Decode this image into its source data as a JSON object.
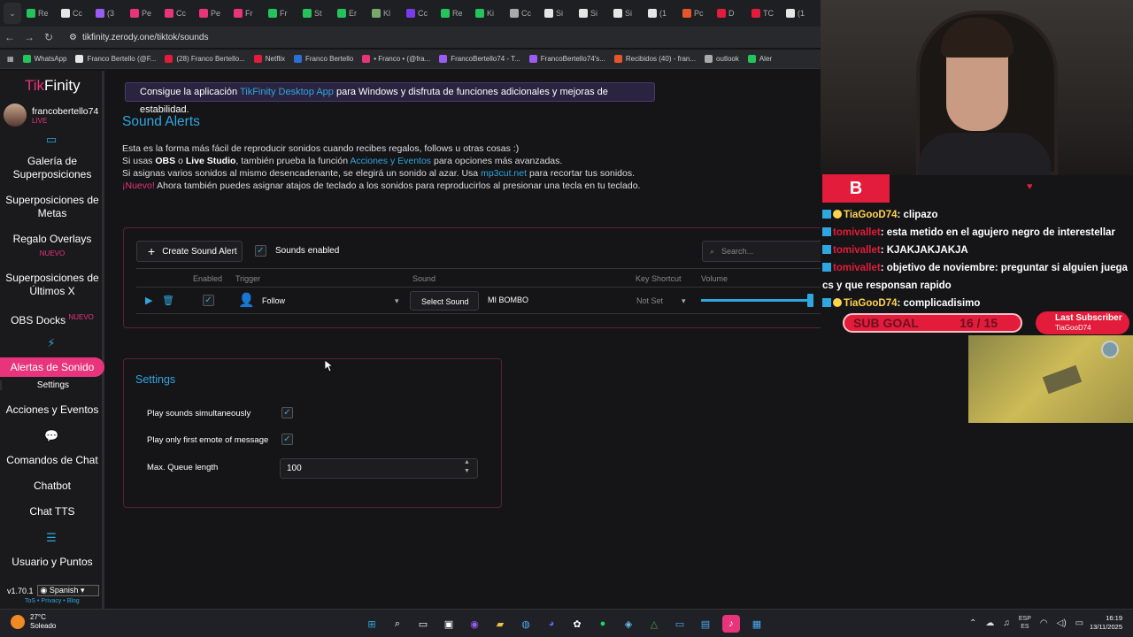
{
  "browser": {
    "tabs": [
      {
        "label": "Re",
        "color": "#24c45c"
      },
      {
        "label": "Cc",
        "color": "#e6e6e6"
      },
      {
        "label": "(3",
        "color": "#9b5cf6"
      },
      {
        "label": "Pe",
        "color": "#e8347a"
      },
      {
        "label": "Cc",
        "color": "#e8347a"
      },
      {
        "label": "Pe",
        "color": "#e8347a"
      },
      {
        "label": "Fr",
        "color": "#e8347a"
      },
      {
        "label": "Fr",
        "color": "#24c45c"
      },
      {
        "label": "St",
        "color": "#24c45c"
      },
      {
        "label": "Er",
        "color": "#24c45c"
      },
      {
        "label": "Kl",
        "color": "#7aa86b"
      },
      {
        "label": "Cc",
        "color": "#7c3aed"
      },
      {
        "label": "Re",
        "color": "#24c45c"
      },
      {
        "label": "Ki",
        "color": "#24c45c"
      },
      {
        "label": "Cc",
        "color": "#aaaaaa"
      },
      {
        "label": "Si",
        "color": "#e6e6e6"
      },
      {
        "label": "Si",
        "color": "#e6e6e6"
      },
      {
        "label": "Si",
        "color": "#e6e6e6"
      },
      {
        "label": "(1",
        "color": "#e6e6e6"
      },
      {
        "label": "Pc",
        "color": "#e8552a"
      },
      {
        "label": "D",
        "color": "#e21c3a"
      },
      {
        "label": "TC",
        "color": "#e21c3a"
      },
      {
        "label": "(1",
        "color": "#e6e6e6"
      },
      {
        "label": "",
        "color": "#e6d3a0"
      }
    ],
    "url": "tikfinity.zerody.one/tiktok/sounds",
    "bookmarks": [
      {
        "label": "WhatsApp",
        "color": "#24c45c"
      },
      {
        "label": "Franco Bertello (@F...",
        "color": "#e6e6e6"
      },
      {
        "label": "(28) Franco Bertello...",
        "color": "#e21c3a"
      },
      {
        "label": "Netflix",
        "color": "#e21c3a"
      },
      {
        "label": "Franco Bertello",
        "color": "#2b6fd6"
      },
      {
        "label": "• Franco • (@fra...",
        "color": "#e8347a"
      },
      {
        "label": "FrancoBertello74 - T...",
        "color": "#9b5cf6"
      },
      {
        "label": "FrancoBertello74's...",
        "color": "#9b5cf6"
      },
      {
        "label": "Recibidos (40) - fran...",
        "color": "#e8552a"
      },
      {
        "label": "outlook",
        "color": "#aaaaaa"
      },
      {
        "label": "Aler",
        "color": "#24c45c"
      }
    ]
  },
  "sidebar": {
    "logo_a": "Tik",
    "logo_b": "Finity",
    "username": "francobertello74",
    "status": "LIVE",
    "items": {
      "galeria": "Galería de Superposiciones",
      "metas": "Superposiciones de Metas",
      "regalo": "Regalo Overlays",
      "regalo_badge": "NUEVO",
      "ultimos": "Superposiciones de Últimos X",
      "obs": "OBS Docks",
      "obs_badge": "NUEVO",
      "alertas": "Alertas de Sonido",
      "settings": "Settings",
      "acciones": "Acciones y Eventos",
      "comandos": "Comandos de Chat",
      "chatbot": "Chatbot",
      "tts": "Chat TTS",
      "usuario": "Usuario y Puntos"
    },
    "version": "v1.70.1",
    "language": "Spanish",
    "links": "ToS • Privacy • Blog"
  },
  "main": {
    "banner_pre": "Consigue la aplicación ",
    "banner_link": "TikFinity Desktop App",
    "banner_post": " para Windows y disfruta de funciones adicionales y mejoras de estabilidad.",
    "title": "Sound Alerts",
    "desc1": "Esta es la forma más fácil de reproducir sonidos cuando recibes regalos, follows u otras cosas :)",
    "desc2_a": "Si usas ",
    "desc2_b": "OBS",
    "desc2_c": " o ",
    "desc2_d": "Live Studio",
    "desc2_e": ", también prueba la función ",
    "desc2_link": "Acciones y Eventos",
    "desc2_f": " para opciones más avanzadas.",
    "desc3_a": "Si asignas varios sonidos al mismo desencadenante, se elegirá un sonido al azar. Usa ",
    "desc3_link": "mp3cut.net",
    "desc3_b": " para recortar tus sonidos.",
    "desc4_nuevo": "¡Nuevo!",
    "desc4": " Ahora también puedes asignar atajos de teclado a los sonidos para reproducirlos al presionar una tecla en tu teclado.",
    "create_label": "Create Sound Alert",
    "sounds_enabled": "Sounds enabled",
    "search_placeholder": "Search...",
    "columns": {
      "enabled": "Enabled",
      "trigger": "Trigger",
      "sound": "Sound",
      "key": "Key Shortcut",
      "volume": "Volume"
    },
    "row": {
      "trigger": "Follow",
      "select_sound": "Select Sound",
      "sound_name": "MI BOMBO",
      "key": "Not Set",
      "volume": 0.98
    },
    "settings": {
      "title": "Settings",
      "simultaneous": "Play sounds simultaneously",
      "first_emote": "Play only first emote of message",
      "queue_label": "Max. Queue length",
      "queue_value": "100"
    }
  },
  "stream": {
    "badge": "B",
    "chat": [
      {
        "nick": "TiaGooD74",
        "text": ": clipazo",
        "style": "yellow"
      },
      {
        "nick": "tomivallet",
        "text": ": esta metido en el agujero negro de interestellar",
        "style": "red"
      },
      {
        "nick": "tomivallet",
        "text": ": KJAKJAKJAKJA",
        "style": "red"
      },
      {
        "nick": "tomivallet",
        "text": ": objetivo de noviembre: preguntar si alguien juega cs y que responsan rapido",
        "style": "red"
      },
      {
        "nick": "TiaGooD74",
        "text": ": complicadisimo",
        "style": "yellow"
      }
    ],
    "subgoal_label": "SUB GOAL",
    "subgoal_value": "16 / 15",
    "lastsub_title": "Last Subscriber",
    "lastsub_name": "TiaGooD74"
  },
  "taskbar": {
    "temp": "27°C",
    "weather": "Soleado",
    "lang_a": "ESP",
    "lang_b": "ES",
    "time": "16:19",
    "date": "13/11/2025"
  }
}
